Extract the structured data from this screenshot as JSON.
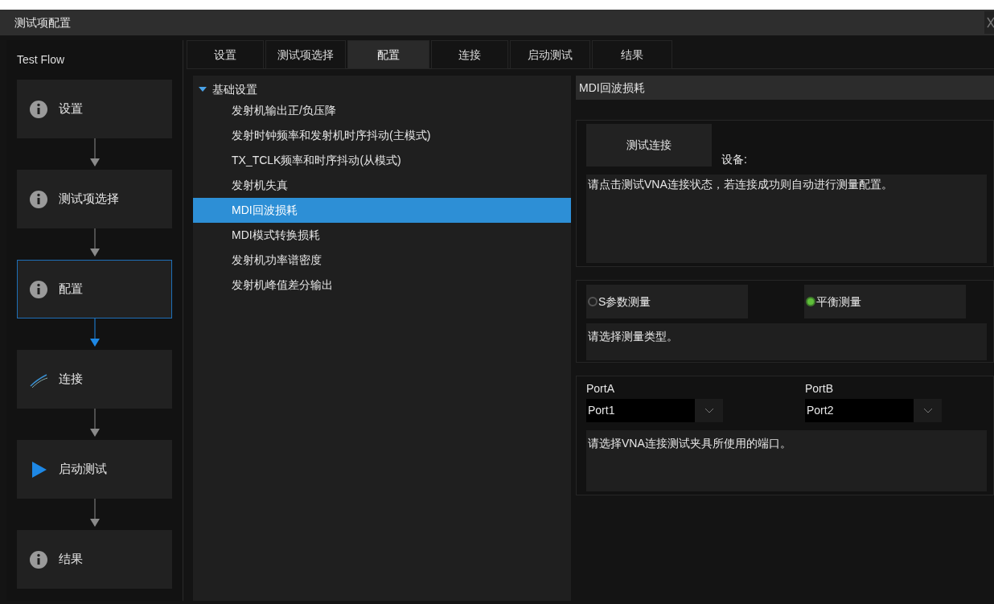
{
  "window": {
    "title": "测试项配置"
  },
  "sidebar": {
    "title": "Test Flow",
    "steps": [
      {
        "label": "设置",
        "kind": "info",
        "selected": false
      },
      {
        "label": "测试项选择",
        "kind": "info",
        "selected": false
      },
      {
        "label": "配置",
        "kind": "info",
        "selected": true
      },
      {
        "label": "连接",
        "kind": "connect",
        "selected": false
      },
      {
        "label": "启动测试",
        "kind": "play",
        "selected": false
      },
      {
        "label": "结果",
        "kind": "info",
        "selected": false
      }
    ]
  },
  "tabs": [
    {
      "label": "设置",
      "selected": false
    },
    {
      "label": "测试项选择",
      "selected": false
    },
    {
      "label": "配置",
      "selected": true
    },
    {
      "label": "连接",
      "selected": false
    },
    {
      "label": "启动测试",
      "selected": false
    },
    {
      "label": "结果",
      "selected": false
    }
  ],
  "tree": {
    "label": "基础设置",
    "expanded": true,
    "children": [
      {
        "label": "发射机输出正/负压降",
        "selected": false
      },
      {
        "label": "发射时钟频率和发射机时序抖动(主模式)",
        "selected": false
      },
      {
        "label": "TX_TCLK频率和时序抖动(从模式)",
        "selected": false
      },
      {
        "label": "发射机失真",
        "selected": false
      },
      {
        "label": "MDI回波损耗",
        "selected": true
      },
      {
        "label": "MDI模式转换损耗",
        "selected": false
      },
      {
        "label": "发射机功率谱密度",
        "selected": false
      },
      {
        "label": "发射机峰值差分输出",
        "selected": false
      }
    ]
  },
  "detail": {
    "title": "MDI回波损耗",
    "connect_button": "测试连接",
    "device_label": "设备:",
    "connect_note": "请点击测试VNA连接状态，若连接成功则自动进行测量配置。",
    "measure_types": [
      {
        "label": "S参数测量",
        "selected": false
      },
      {
        "label": "平衡测量",
        "selected": true
      }
    ],
    "measure_note": "请选择测量类型。",
    "ports": [
      {
        "label": "PortA",
        "value": "Port1"
      },
      {
        "label": "PortB",
        "value": "Port2"
      }
    ],
    "port_note": "请选择VNA连接测试夹具所使用的端口。"
  }
}
